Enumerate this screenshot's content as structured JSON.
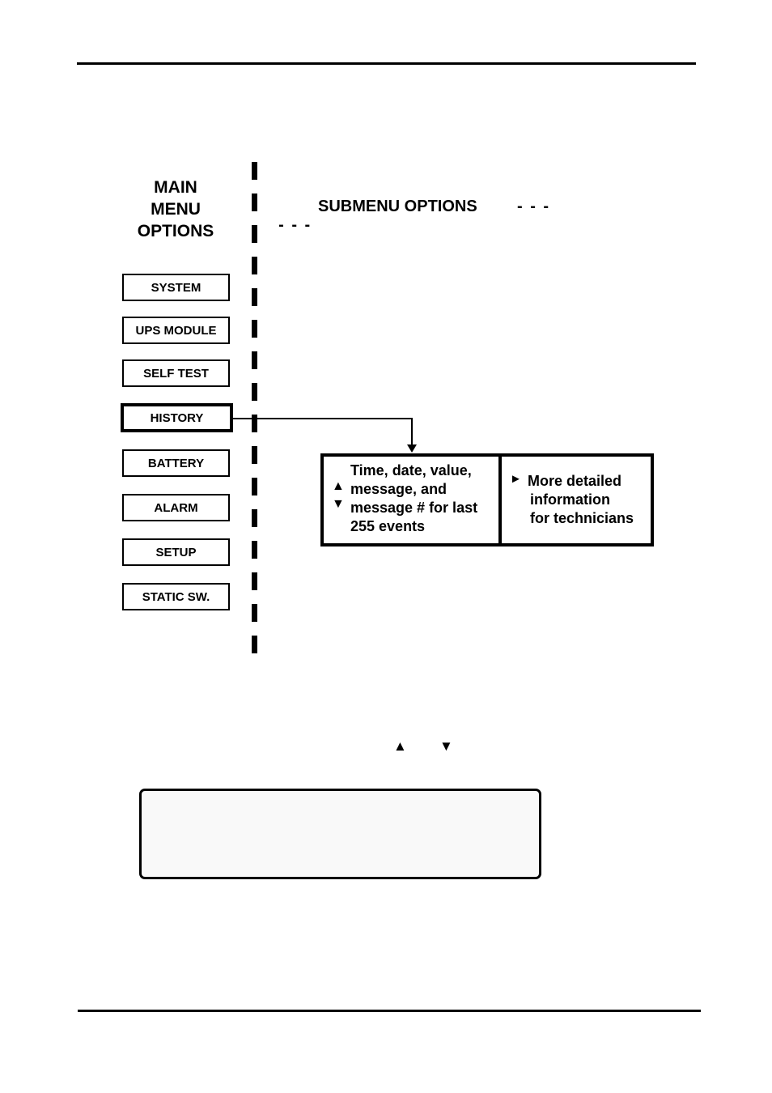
{
  "main_menu": {
    "heading": [
      "MAIN",
      "MENU",
      "OPTIONS"
    ],
    "items": [
      {
        "label": "SYSTEM",
        "selected": false
      },
      {
        "label": "UPS MODULE",
        "selected": false
      },
      {
        "label": "SELF TEST",
        "selected": false
      },
      {
        "label": "HISTORY",
        "selected": true
      },
      {
        "label": "BATTERY",
        "selected": false
      },
      {
        "label": "ALARM",
        "selected": false
      },
      {
        "label": "SETUP",
        "selected": false
      },
      {
        "label": "STATIC SW.",
        "selected": false
      }
    ]
  },
  "submenu": {
    "heading": "SUBMENU OPTIONS",
    "heading_dashes": "- - -",
    "history_panel": {
      "scroll_up_icon": "▲",
      "scroll_down_icon": "▼",
      "left_text": "Time, date, value, message, and message # for last 255 events",
      "right_arrow_icon": "►",
      "right_text": [
        "More detailed",
        "information",
        "for technicians"
      ]
    }
  },
  "keys": {
    "up": "▲",
    "down": "▼"
  },
  "lcd_display": {
    "lines": []
  }
}
